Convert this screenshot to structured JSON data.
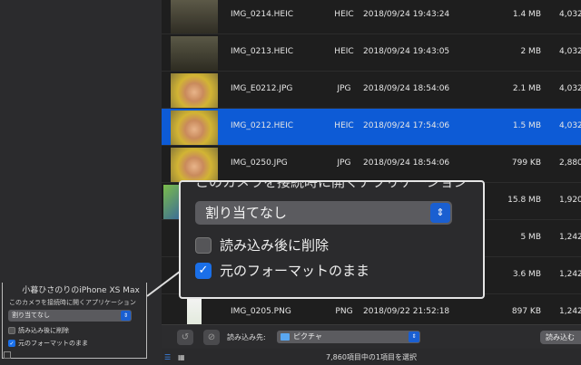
{
  "sidebar": {
    "device_name": "小暮ひさのりのiPhone XS Max",
    "app_label": "このカメラを接続時に開くアプリケーション",
    "app_value": "割り当てなし",
    "delete_after_import": "読み込み後に削除",
    "keep_original": "元のフォーマットのまま"
  },
  "files": [
    {
      "name": "IMG_0214.HEIC",
      "type": "HEIC",
      "date": "2018/09/24 19:43:24",
      "size": "1.4 MB",
      "dim": "4,032",
      "selected": false
    },
    {
      "name": "IMG_0213.HEIC",
      "type": "HEIC",
      "date": "2018/09/24 19:43:05",
      "size": "2 MB",
      "dim": "4,032",
      "selected": false
    },
    {
      "name": "IMG_E0212.JPG",
      "type": "JPG",
      "date": "2018/09/24 18:54:06",
      "size": "2.1 MB",
      "dim": "4,032",
      "selected": false
    },
    {
      "name": "IMG_0212.HEIC",
      "type": "HEIC",
      "date": "2018/09/24 17:54:06",
      "size": "1.5 MB",
      "dim": "4,032",
      "selected": true
    },
    {
      "name": "IMG_0250.JPG",
      "type": "JPG",
      "date": "2018/09/24 18:54:06",
      "size": "799 KB",
      "dim": "2,880",
      "selected": false
    },
    {
      "name": "",
      "type": "",
      "date": "",
      "size": "15.8 MB",
      "dim": "1,920",
      "selected": false
    },
    {
      "name": "",
      "type": "",
      "date": "",
      "size": "5 MB",
      "dim": "1,242",
      "selected": false
    },
    {
      "name": "",
      "type": "",
      "date": "",
      "size": "3.6 MB",
      "dim": "1,242",
      "selected": false
    },
    {
      "name": "IMG_0205.PNG",
      "type": "PNG",
      "date": "2018/09/22 21:52:18",
      "size": "897 KB",
      "dim": "1,242",
      "selected": false
    }
  ],
  "popup": {
    "title": "このカメラを接続時に開くアプリケーション",
    "app_value": "割り当てなし",
    "delete_after_import": "読み込み後に削除",
    "keep_original": "元のフォーマットのまま"
  },
  "toolbar": {
    "import_to_label": "読み込み先:",
    "destination": "ピクチャ",
    "import_button": "読み込む"
  },
  "status": {
    "text": "7,860項目中の1項目を選択"
  },
  "colors": {
    "selection": "#0d5bd6",
    "accent": "#1a6fe8"
  }
}
